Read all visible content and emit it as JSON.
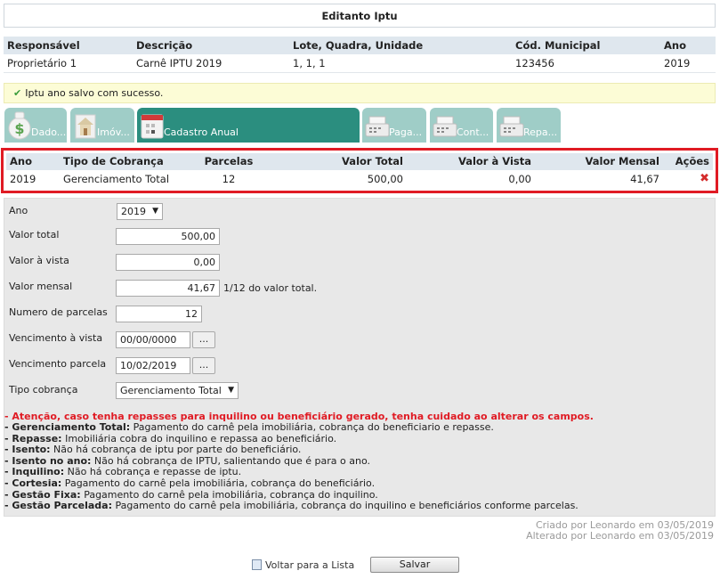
{
  "title": "Editanto Iptu",
  "info": {
    "headers": [
      "Responsável",
      "Descrição",
      "Lote, Quadra, Unidade",
      "Cód. Municipal",
      "Ano"
    ],
    "row": [
      "Proprietário 1",
      "Carnê IPTU 2019",
      "1, 1, 1",
      "123456",
      "2019"
    ]
  },
  "message": "Iptu ano salvo com sucesso.",
  "tabs": [
    {
      "label": "Dado...",
      "icon": "money-bag-icon"
    },
    {
      "label": "Imóv...",
      "icon": "house-icon"
    },
    {
      "label": "Cadastro Anual",
      "icon": "calendar-icon"
    },
    {
      "label": "Paga...",
      "icon": "cash-register-icon"
    },
    {
      "label": "Cont...",
      "icon": "cash-register-icon"
    },
    {
      "label": "Repa...",
      "icon": "cash-register-icon"
    }
  ],
  "anual": {
    "headers": [
      "Ano",
      "Tipo de Cobrança",
      "Parcelas",
      "Valor Total",
      "Valor à Vista",
      "Valor Mensal",
      "Ações"
    ],
    "row": {
      "ano": "2019",
      "tipo": "Gerenciamento Total",
      "parcelas": "12",
      "total": "500,00",
      "vista": "0,00",
      "mensal": "41,67"
    }
  },
  "form": {
    "ano": {
      "label": "Ano",
      "value": "2019"
    },
    "valor_total": {
      "label": "Valor total",
      "value": "500,00"
    },
    "valor_vista": {
      "label": "Valor à vista",
      "value": "0,00"
    },
    "valor_mensal": {
      "label": "Valor mensal",
      "value": "41,67",
      "hint": "1/12 do valor total."
    },
    "num_parcelas": {
      "label": "Numero de parcelas",
      "value": "12"
    },
    "venc_vista": {
      "label": "Vencimento à vista",
      "value": "00/00/0000",
      "button": "..."
    },
    "venc_parcela": {
      "label": "Vencimento parcela",
      "value": "10/02/2019",
      "button": "..."
    },
    "tipo_cobranca": {
      "label": "Tipo cobrança",
      "value": "Gerenciamento Total"
    }
  },
  "notes": {
    "warning": "- Atenção, caso tenha repasses para inquilino ou beneficiário gerado, tenha cuidado ao alterar os campos.",
    "items": [
      {
        "term": "- Gerenciamento Total:",
        "text": " Pagamento do carnê pela imobiliária, cobrança do beneficiario e repasse."
      },
      {
        "term": "- Repasse:",
        "text": " Imobiliária cobra do inquilino e repassa ao beneficiário."
      },
      {
        "term": "- Isento:",
        "text": " Não há cobrança de iptu por parte do beneficiário."
      },
      {
        "term": "- Isento no ano:",
        "text": " Não há cobrança de IPTU, salientando que é para o ano."
      },
      {
        "term": "- Inquilino:",
        "text": " Não há cobrança e repasse de iptu."
      },
      {
        "term": "- Cortesia:",
        "text": " Pagamento do carnê pela imobiliária, cobrança do beneficiário."
      },
      {
        "term": "- Gestão Fixa:",
        "text": " Pagamento do carnê pela imobiliária, cobrança do inquilino."
      },
      {
        "term": "- Gestão Parcelada:",
        "text": " Pagamento do carnê pela imobiliária, cobrança do inquilino e beneficiários conforme parcelas."
      }
    ]
  },
  "meta": {
    "created": "Criado por Leonardo em 03/05/2019",
    "updated": "Alterado por Leonardo em 03/05/2019"
  },
  "footer": {
    "back": "Voltar para a Lista",
    "save": "Salvar"
  }
}
